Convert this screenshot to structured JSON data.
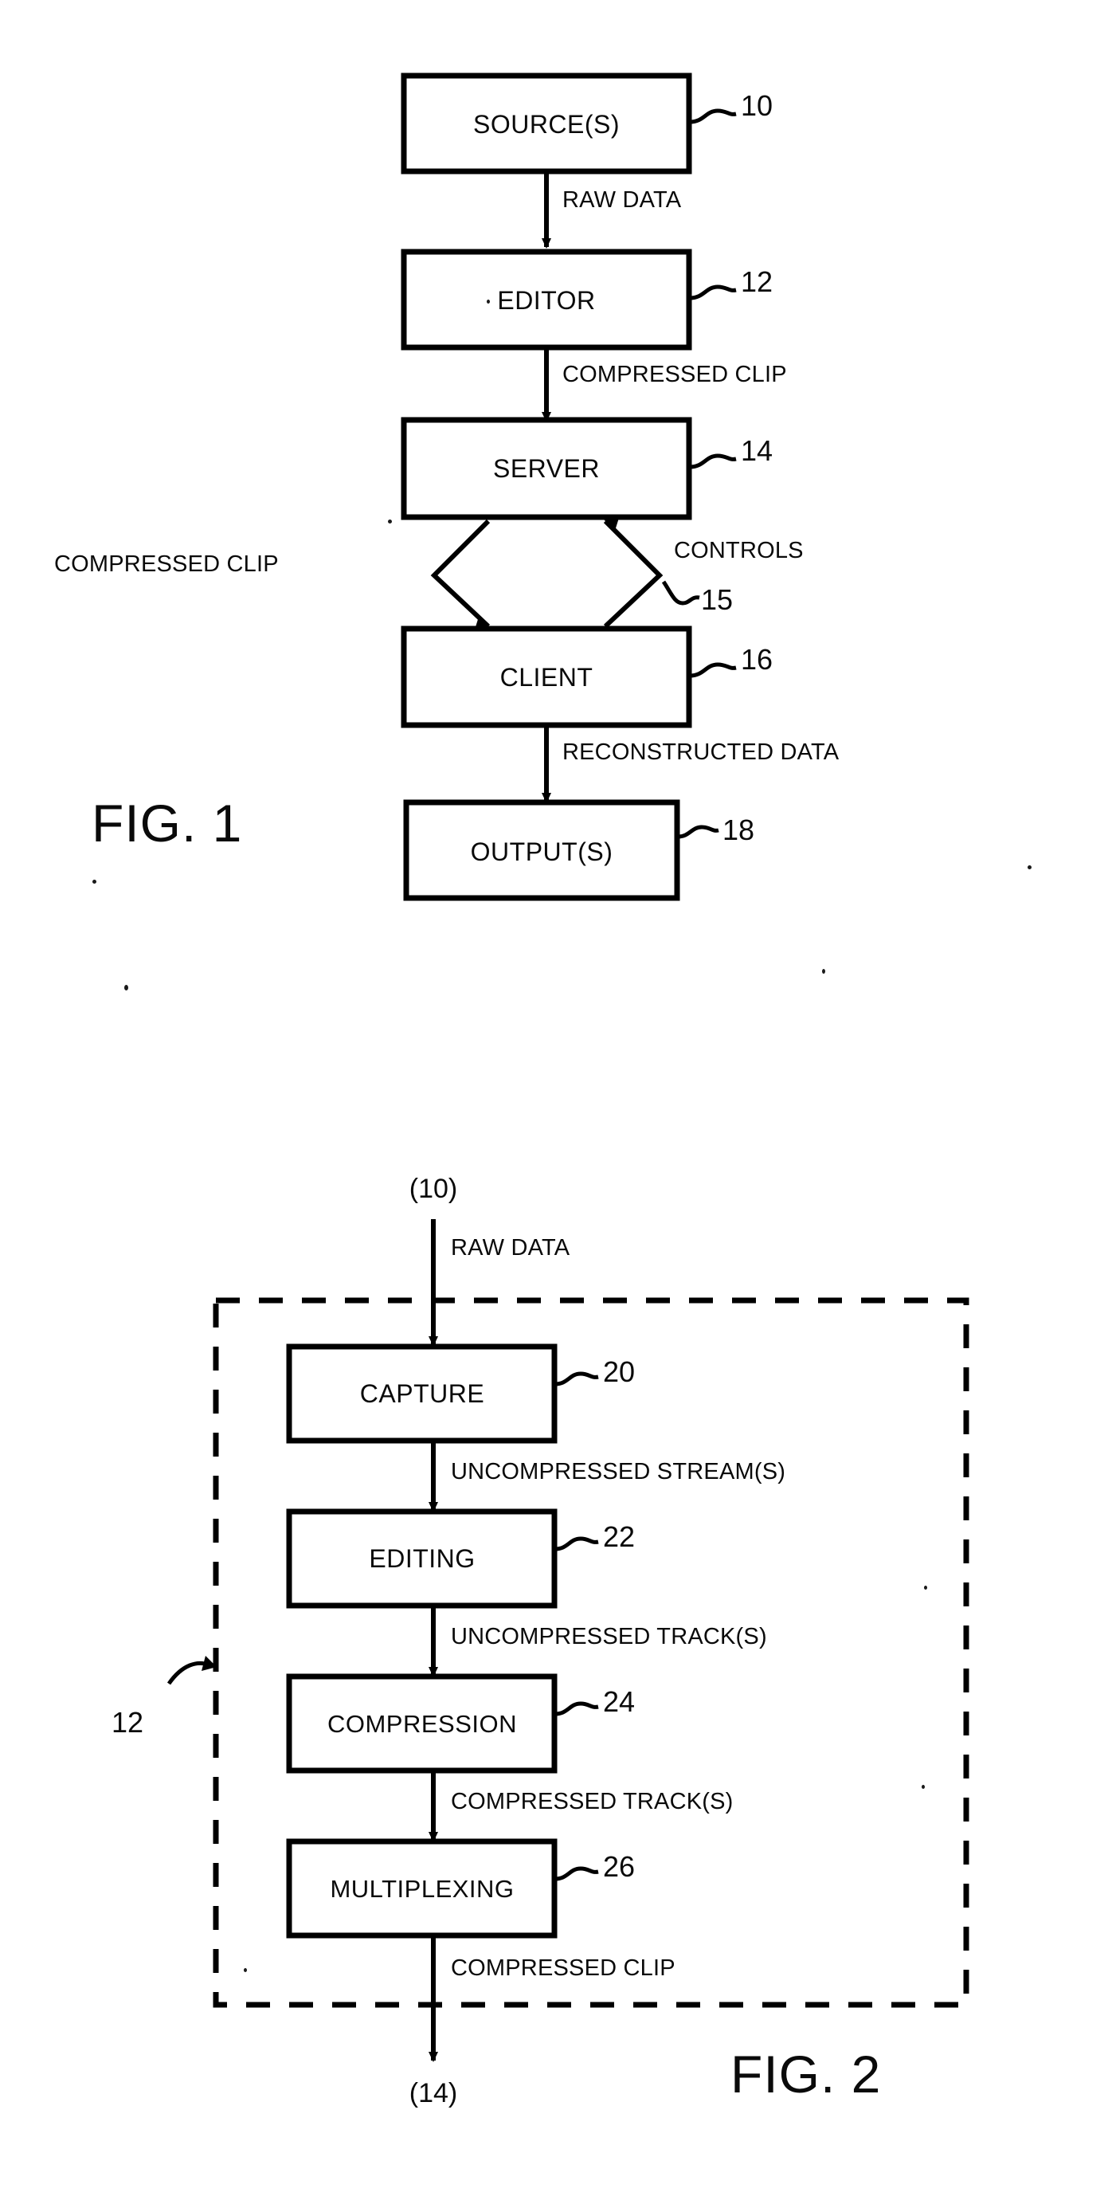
{
  "document": {
    "kind": "patent-drawing-sheet",
    "figures": [
      {
        "id": "fig1",
        "title": "FIG. 1",
        "type": "block-flow-diagram",
        "blocks": [
          {
            "label": "SOURCE(S)",
            "ref": "10"
          },
          {
            "label": "EDITOR",
            "ref": "12"
          },
          {
            "label": "SERVER",
            "ref": "14"
          },
          {
            "label": "CLIENT",
            "ref": "16"
          },
          {
            "label": "OUTPUT(S)",
            "ref": "18"
          }
        ],
        "connections": [
          {
            "label": "RAW DATA",
            "from": "SOURCE(S)",
            "to": "EDITOR",
            "direction": "down"
          },
          {
            "label": "COMPRESSED CLIP",
            "from": "EDITOR",
            "to": "SERVER",
            "direction": "down"
          },
          {
            "label": "COMPRESSED CLIP",
            "from": "SERVER",
            "to": "CLIENT",
            "direction": "down"
          },
          {
            "label": "CONTROLS",
            "from": "CLIENT",
            "to": "SERVER",
            "direction": "up"
          },
          {
            "label": "RECONSTRUCTED DATA",
            "from": "CLIENT",
            "to": "OUTPUT(S)",
            "direction": "down"
          }
        ],
        "link_ref": "15"
      },
      {
        "id": "fig2",
        "title": "FIG. 2",
        "type": "block-flow-diagram",
        "enclosure_ref": "12",
        "input_ref": "(10)",
        "output_ref": "(14)",
        "blocks": [
          {
            "label": "CAPTURE",
            "ref": "20"
          },
          {
            "label": "EDITING",
            "ref": "22"
          },
          {
            "label": "COMPRESSION",
            "ref": "24"
          },
          {
            "label": "MULTIPLEXING",
            "ref": "26"
          }
        ],
        "connections": [
          {
            "label": "RAW DATA",
            "from": "(10)",
            "to": "CAPTURE",
            "direction": "down"
          },
          {
            "label": "UNCOMPRESSED STREAM(S)",
            "from": "CAPTURE",
            "to": "EDITING",
            "direction": "down"
          },
          {
            "label": "UNCOMPRESSED TRACK(S)",
            "from": "EDITING",
            "to": "COMPRESSION",
            "direction": "down"
          },
          {
            "label": "COMPRESSED TRACK(S)",
            "from": "COMPRESSION",
            "to": "MULTIPLEXING",
            "direction": "down"
          },
          {
            "label": "COMPRESSED CLIP",
            "from": "MULTIPLEXING",
            "to": "(14)",
            "direction": "down"
          }
        ]
      }
    ]
  },
  "fig1": {
    "title": "FIG. 1",
    "blocks": {
      "sources": "SOURCE(S)",
      "editor": "EDITOR",
      "server": "SERVER",
      "client": "CLIENT",
      "outputs": "OUTPUT(S)"
    },
    "refs": {
      "sources": "10",
      "editor": "12",
      "server": "14",
      "link": "15",
      "client": "16",
      "outputs": "18"
    },
    "flows": {
      "raw_data": "RAW DATA",
      "compressed_clip_editor_server": "COMPRESSED CLIP",
      "compressed_clip_server_client": "COMPRESSED CLIP",
      "controls": "CONTROLS",
      "reconstructed_data": "RECONSTRUCTED DATA"
    }
  },
  "fig2": {
    "title": "FIG. 2",
    "blocks": {
      "capture": "CAPTURE",
      "editing": "EDITING",
      "compression": "COMPRESSION",
      "multiplexing": "MULTIPLEXING"
    },
    "refs": {
      "capture": "20",
      "editing": "22",
      "compression": "24",
      "multiplexing": "26",
      "enclosure": "12",
      "input": "(10)",
      "output": "(14)"
    },
    "flows": {
      "raw_data": "RAW DATA",
      "uncompressed_streams": "UNCOMPRESSED STREAM(S)",
      "uncompressed_tracks": "UNCOMPRESSED TRACK(S)",
      "compressed_tracks": "COMPRESSED TRACK(S)",
      "compressed_clip": "COMPRESSED CLIP"
    }
  },
  "colors": {
    "ink": "#000000",
    "paper": "#ffffff"
  }
}
